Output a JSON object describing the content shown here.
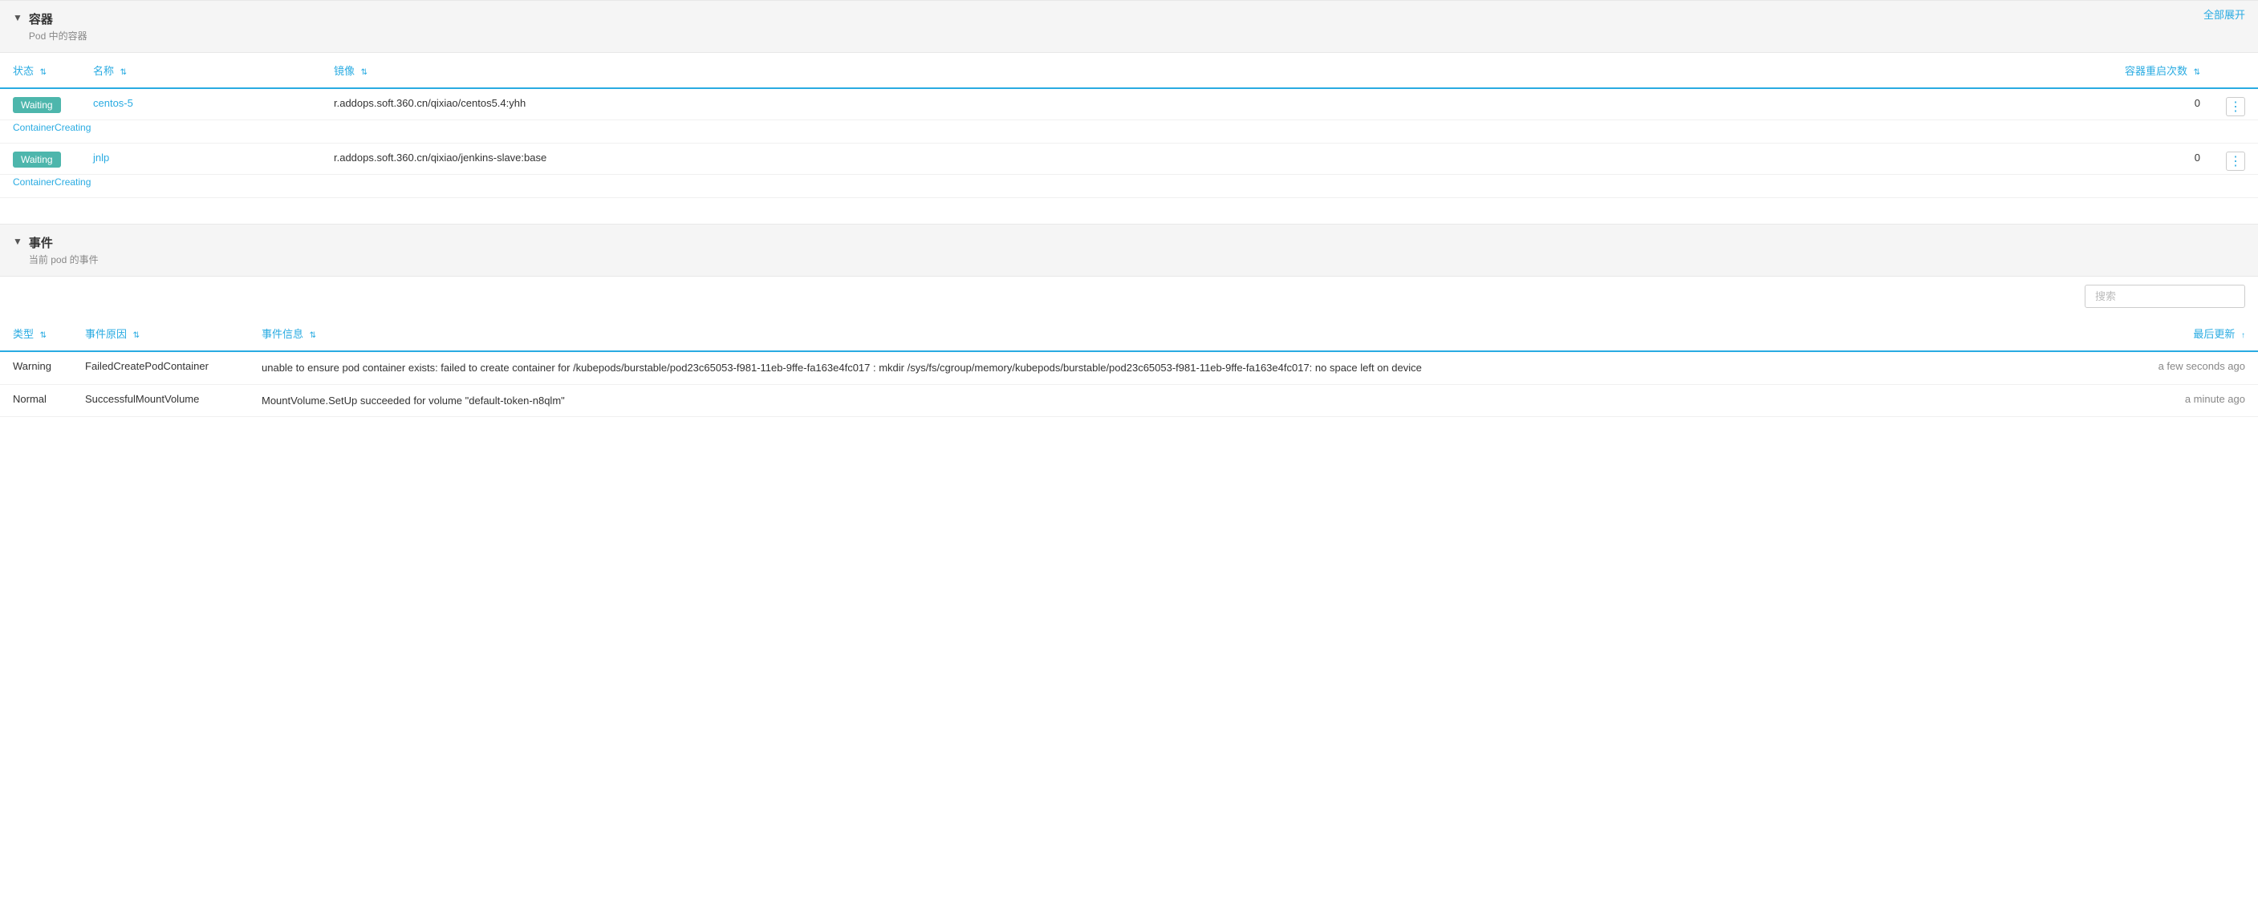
{
  "page": {
    "expand_all_label": "全部展开"
  },
  "containers_section": {
    "toggle": "▼",
    "title": "容器",
    "subtitle": "Pod 中的容器",
    "columns": {
      "status": "状态",
      "name": "名称",
      "image": "镜像",
      "restarts": "容器重启次数"
    },
    "rows": [
      {
        "status": "Waiting",
        "name": "centos-5",
        "image": "r.addops.soft.360.cn/qixiao/centos5.4:yhh",
        "restarts": "0",
        "sub_text": "ContainerCreating"
      },
      {
        "status": "Waiting",
        "name": "jnlp",
        "image": "r.addops.soft.360.cn/qixiao/jenkins-slave:base",
        "restarts": "0",
        "sub_text": "ContainerCreating"
      }
    ]
  },
  "events_section": {
    "toggle": "▼",
    "title": "事件",
    "subtitle": "当前 pod 的事件",
    "search_placeholder": "搜索",
    "columns": {
      "type": "类型",
      "reason": "事件原因",
      "message": "事件信息",
      "updated": "最后更新"
    },
    "rows": [
      {
        "type": "Warning",
        "reason": "FailedCreatePodContainer",
        "message": "unable to ensure pod container exists: failed to create container for /kubepods/burstable/pod23c65053-f981-11eb-9ffe-fa163e4fc017 : mkdir /sys/fs/cgroup/memory/kubepods/burstable/pod23c65053-f981-11eb-9ffe-fa163e4fc017: no space left on device",
        "updated": "a few seconds ago"
      },
      {
        "type": "Normal",
        "reason": "SuccessfulMountVolume",
        "message": "MountVolume.SetUp succeeded for volume \"default-token-n8qlm\"",
        "updated": "a minute ago"
      }
    ]
  }
}
